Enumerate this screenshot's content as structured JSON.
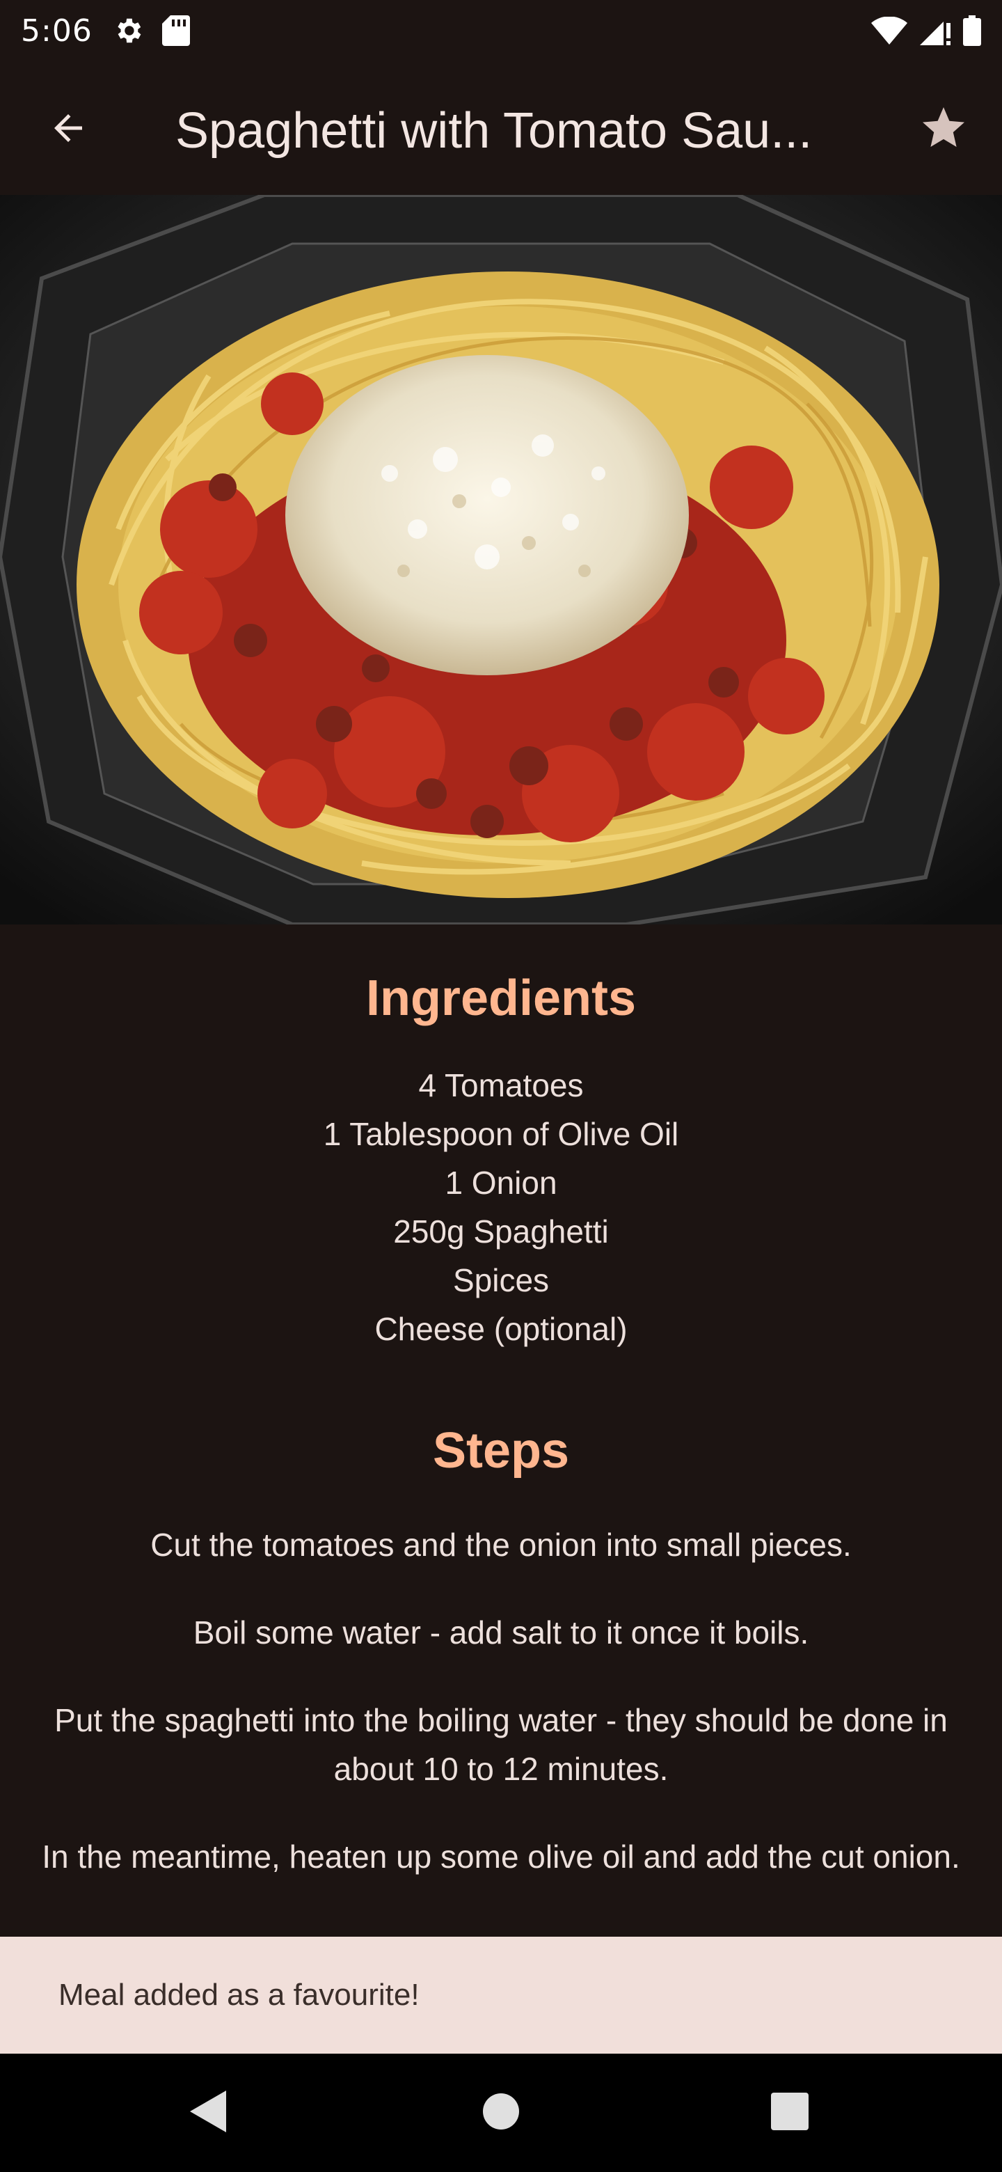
{
  "status_bar": {
    "time": "5:06",
    "icons": [
      "settings-icon",
      "sd-card-icon",
      "wifi-icon",
      "signal-icon",
      "battery-icon"
    ]
  },
  "app_bar": {
    "title": "Spaghetti with Tomato Sau...",
    "back_icon": "arrow-back-icon",
    "favorite_icon": "star-icon"
  },
  "hero_image": {
    "description_icon": "meal-photo"
  },
  "ingredients": {
    "title": "Ingredients",
    "items": [
      "4 Tomatoes",
      "1 Tablespoon of Olive Oil",
      "1 Onion",
      "250g Spaghetti",
      "Spices",
      "Cheese (optional)"
    ]
  },
  "steps": {
    "title": "Steps",
    "items": [
      "Cut the tomatoes and the onion into small pieces.",
      "Boil some water - add salt to it once it boils.",
      "Put the spaghetti into the boiling water - they should be done in about 10 to 12 minutes.",
      "In the meantime, heaten up some olive oil and add the cut onion."
    ]
  },
  "snackbar": {
    "message": "Meal added as a favourite!"
  },
  "colors": {
    "background": "#1c1412",
    "accent": "#ffb68f",
    "text": "#ede0dc",
    "snackbar_bg": "#f1dfda"
  }
}
